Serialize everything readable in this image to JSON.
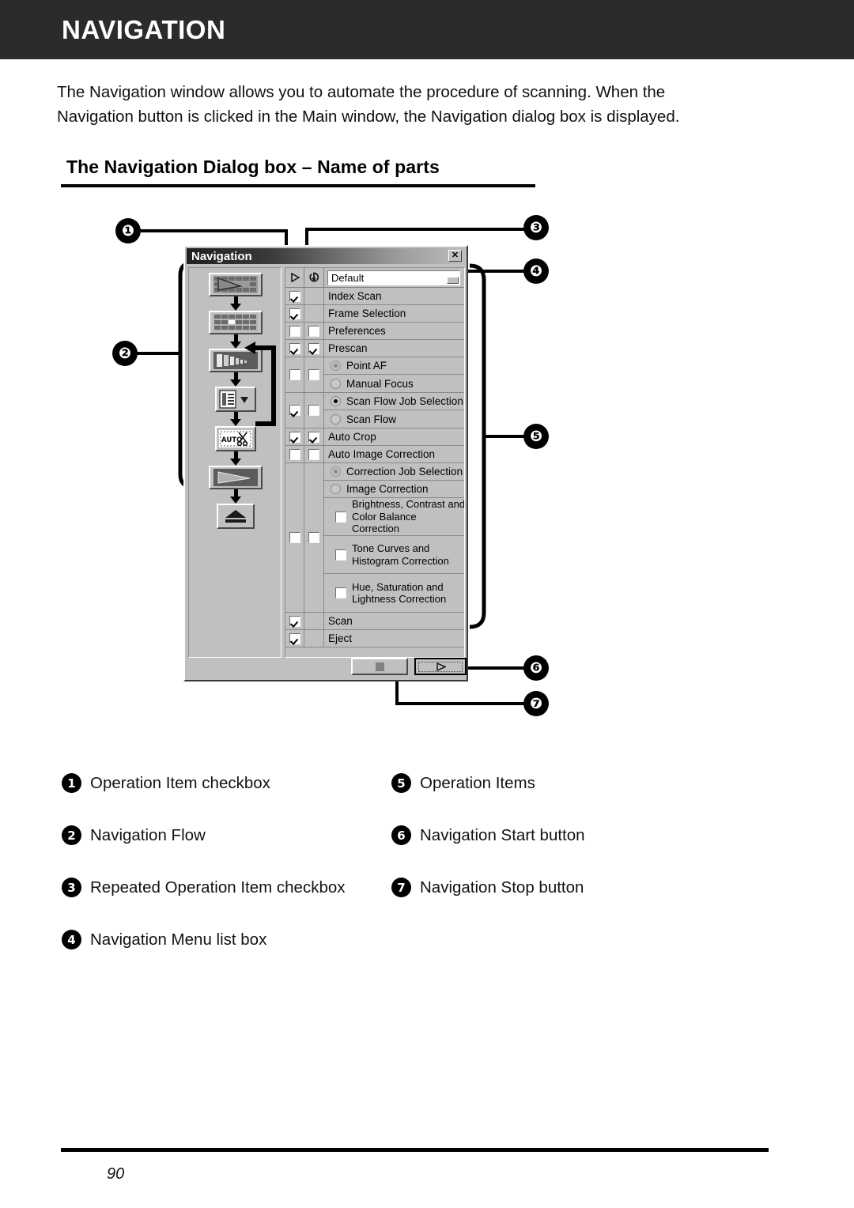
{
  "header": {
    "title": "NAVIGATION"
  },
  "intro": {
    "paragraph": "The Navigation window allows you to automate the procedure of scanning. When the Navigation button is clicked in the Main window, the Navigation dialog box is displayed."
  },
  "section": {
    "heading": "The Navigation Dialog box – Name of parts"
  },
  "dialog": {
    "title": "Navigation",
    "close_label": "✕",
    "header_play_icon": "play-triangle-icon",
    "header_repeat_icon": "repeat-loop-icon",
    "menu_value": "Default",
    "flow_icons": [
      {
        "name": "index-scan-icon",
        "label": "Index Scan"
      },
      {
        "name": "frame-selection-icon",
        "label": "Frame Selection"
      },
      {
        "name": "prescan-icon",
        "label": "Prescan"
      },
      {
        "name": "job-select-icon",
        "label": "Job Selection"
      },
      {
        "name": "auto-crop-icon",
        "label": "Auto Crop"
      },
      {
        "name": "scan-icon",
        "label": "Scan"
      },
      {
        "name": "eject-icon",
        "label": "Eject"
      }
    ],
    "rows": [
      {
        "label": "Index Scan",
        "a": "checked",
        "b": "none"
      },
      {
        "label": "Frame Selection",
        "a": "checked",
        "b": "none"
      },
      {
        "label": "Preferences",
        "a": "blank",
        "b": "blank"
      },
      {
        "label": "Prescan",
        "a": "checked",
        "b": "checked"
      },
      {
        "label": "Auto Crop",
        "a": "checked",
        "b": "checked"
      },
      {
        "label": "Auto Image Correction",
        "a": "blank",
        "b": "blank"
      },
      {
        "label": "Scan",
        "a": "checked",
        "b": "none"
      },
      {
        "label": "Eject",
        "a": "checked",
        "b": "none"
      }
    ],
    "focus_group": {
      "a": "blank",
      "b": "blank",
      "options": [
        {
          "label": "Point AF",
          "state": "dim-selected"
        },
        {
          "label": "Manual Focus",
          "state": "unselected"
        }
      ]
    },
    "scanflow_group": {
      "a": "checked",
      "b": "blank",
      "options": [
        {
          "label": "Scan Flow Job Selection",
          "state": "selected"
        },
        {
          "label": "Scan Flow",
          "state": "unselected"
        }
      ]
    },
    "correction_group": {
      "options": [
        {
          "label": "Correction Job Selection",
          "state": "dim-selected"
        },
        {
          "label": "Image Correction",
          "state": "unselected"
        }
      ],
      "sub_items": [
        {
          "label": "Brightness, Contrast and Color Balance Correction",
          "checked": false
        },
        {
          "label": "Tone Curves and Histogram Correction",
          "checked": false
        },
        {
          "label": "Hue, Saturation and Lightness Correction",
          "checked": false
        }
      ]
    },
    "buttons": {
      "stop_icon": "stop-square-icon",
      "start_icon": "start-triangle-icon"
    }
  },
  "callouts": [
    {
      "num": "❶",
      "target": "operation-item-checkbox"
    },
    {
      "num": "❷",
      "target": "navigation-flow"
    },
    {
      "num": "❸",
      "target": "repeated-operation-item-checkbox"
    },
    {
      "num": "❹",
      "target": "navigation-menu-list-box"
    },
    {
      "num": "❺",
      "target": "operation-items"
    },
    {
      "num": "❻",
      "target": "navigation-start-button"
    },
    {
      "num": "❼",
      "target": "navigation-stop-button"
    }
  ],
  "legend": {
    "left": [
      {
        "num": "1",
        "text": "Operation Item checkbox"
      },
      {
        "num": "2",
        "text": "Navigation Flow"
      },
      {
        "num": "3",
        "text": "Repeated Operation Item checkbox"
      },
      {
        "num": "4",
        "text": "Navigation Menu list box"
      }
    ],
    "right": [
      {
        "num": "5",
        "text": "Operation Items"
      },
      {
        "num": "6",
        "text": "Navigation Start button"
      },
      {
        "num": "7",
        "text": "Navigation Stop button"
      }
    ]
  },
  "footer": {
    "page_number": "90"
  }
}
